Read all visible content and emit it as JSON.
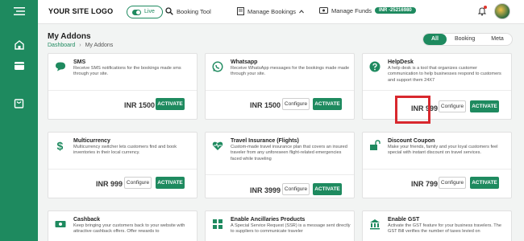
{
  "header": {
    "logo": "YOUR SITE LOGO",
    "live_label": "Live",
    "booking_tool": "Booking Tool",
    "manage_bookings": "Manage Bookings",
    "manage_funds": "Manage Funds",
    "funds_amount": "INR -25216980"
  },
  "page": {
    "title": "My Addons",
    "breadcrumb": [
      "Dashboard",
      "My Addons"
    ]
  },
  "filters": [
    "All",
    "Booking",
    "Meta"
  ],
  "active_filter": "All",
  "cards": [
    {
      "name": "SMS",
      "desc": "Receive SMS notifications for the bookings made sms through your site.",
      "price": "INR 1500",
      "configure": "",
      "activate": "ACTIVATE",
      "icon": "chat-bubble-icon"
    },
    {
      "name": "Whatsapp",
      "desc": "Receive WhatsApp messages for the bookings made made through your site.",
      "price": "INR 1500",
      "configure": "Configure",
      "activate": "ACTIVATE",
      "icon": "whatsapp-icon"
    },
    {
      "name": "HelpDesk",
      "desc": "A help desk is a tool that organizes customer communication to help businesses respond to customers and support them 24X7",
      "price": "INR 999",
      "configure": "Configure",
      "activate": "ACTIVATE",
      "icon": "help-icon"
    },
    {
      "name": "Multicurrency",
      "desc": "Multicurrency switcher lets customers find and book inventories in their local currency.",
      "price": "INR 999",
      "configure": "Configure",
      "activate": "ACTIVATE",
      "icon": "dollar-icon"
    },
    {
      "name": "Travel Insurance (Flights)",
      "desc": "Custom-made travel insurance plan that covers an insured traveler from any unforeseen flight-related emergencies faced while traveling",
      "price": "INR 3999",
      "configure": "Configure",
      "activate": "ACTIVATE",
      "icon": "heartbeat-icon"
    },
    {
      "name": "Discount Coupon",
      "desc": "Make your friends, family and your loyal customers feel special with instant discount on travel services.",
      "price": "INR 799",
      "configure": "Configure",
      "activate": "ACTIVATE",
      "icon": "coupon-icon"
    },
    {
      "name": "Cashback",
      "desc": "Keep bringing your customers back to your website with attractive cashback offers. Offer rewards to",
      "price": "",
      "configure": "",
      "activate": "",
      "icon": "cashback-icon"
    },
    {
      "name": "Enable Ancillaries Products",
      "desc": "A Special Service Request (SSR) is a message sent directly to suppliers to communicate traveler",
      "price": "",
      "configure": "",
      "activate": "",
      "icon": "grid-icon"
    },
    {
      "name": "Enable GST",
      "desc": "Activate the GST feature for your business travelers. The GST Bill verifies the number of taxes levied on",
      "price": "",
      "configure": "",
      "activate": "",
      "icon": "bank-icon"
    }
  ],
  "colors": {
    "brand": "#1e8a5f",
    "highlight": "#d8282e"
  }
}
